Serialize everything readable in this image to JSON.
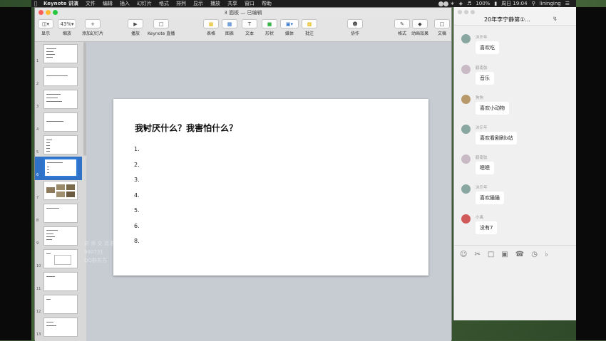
{
  "menubar": {
    "app_name": "Keynote 讲演",
    "items": [
      "文件",
      "编辑",
      "插入",
      "幻灯片",
      "格式",
      "排列",
      "显示",
      "播放",
      "共享",
      "窗口",
      "帮助"
    ],
    "battery": "100%",
    "clock": "周日 19:04",
    "user": "lininging"
  },
  "keynote": {
    "window_title": "3 面板 — 已编辑",
    "toolbar": {
      "view": "显示",
      "zoom_value": "43%",
      "zoom_label": "缩放",
      "add_slide": "添加幻灯片",
      "play": "播放",
      "keynote_live": "Keynote 直播",
      "table": "表格",
      "chart": "图表",
      "text": "文本",
      "shape": "形状",
      "media": "媒体",
      "comment": "批注",
      "collaborate": "协作",
      "format": "格式",
      "animate": "动画效果",
      "document": "文稿"
    },
    "slide_numbers": [
      "1",
      "2",
      "3",
      "4",
      "5",
      "6",
      "7",
      "8",
      "9",
      "10",
      "11",
      "12",
      "13"
    ],
    "thumb_titles": {
      "t2": "我是一名老师是一名助",
      "t6": "我讨厌什么？我害怕什么？"
    },
    "slide": {
      "title": "我讨厌什么？我害怕什么？",
      "items": [
        "1.",
        "2.",
        "3.",
        "4.",
        "5.",
        "6.",
        "8."
      ]
    },
    "watermark": [
      "讲 师 交 流 群",
      "960731",
      "QQ群东方"
    ]
  },
  "chat": {
    "title": "20年李宁静第①...",
    "messages": [
      {
        "sender": "沐斤年",
        "text": "喜欢吃",
        "avatar_color": "#8aa6a0"
      },
      {
        "sender": "鹤南弦",
        "text": "音乐",
        "avatar_color": "#c9b9c4"
      },
      {
        "sender": "狗狗",
        "text": "喜欢小动物",
        "avatar_color": "#b89a6a"
      },
      {
        "sender": "沐斤年",
        "text": "喜欢看剧刷b站",
        "avatar_color": "#8aa6a0"
      },
      {
        "sender": "鹤南弦",
        "text": "嗯嗯",
        "avatar_color": "#c9b9c4"
      },
      {
        "sender": "沐斤年",
        "text": "喜欢猫猫",
        "avatar_color": "#8aa6a0"
      },
      {
        "sender": "小禹",
        "text": "没有7",
        "avatar_color": "#d05a5a"
      }
    ]
  }
}
